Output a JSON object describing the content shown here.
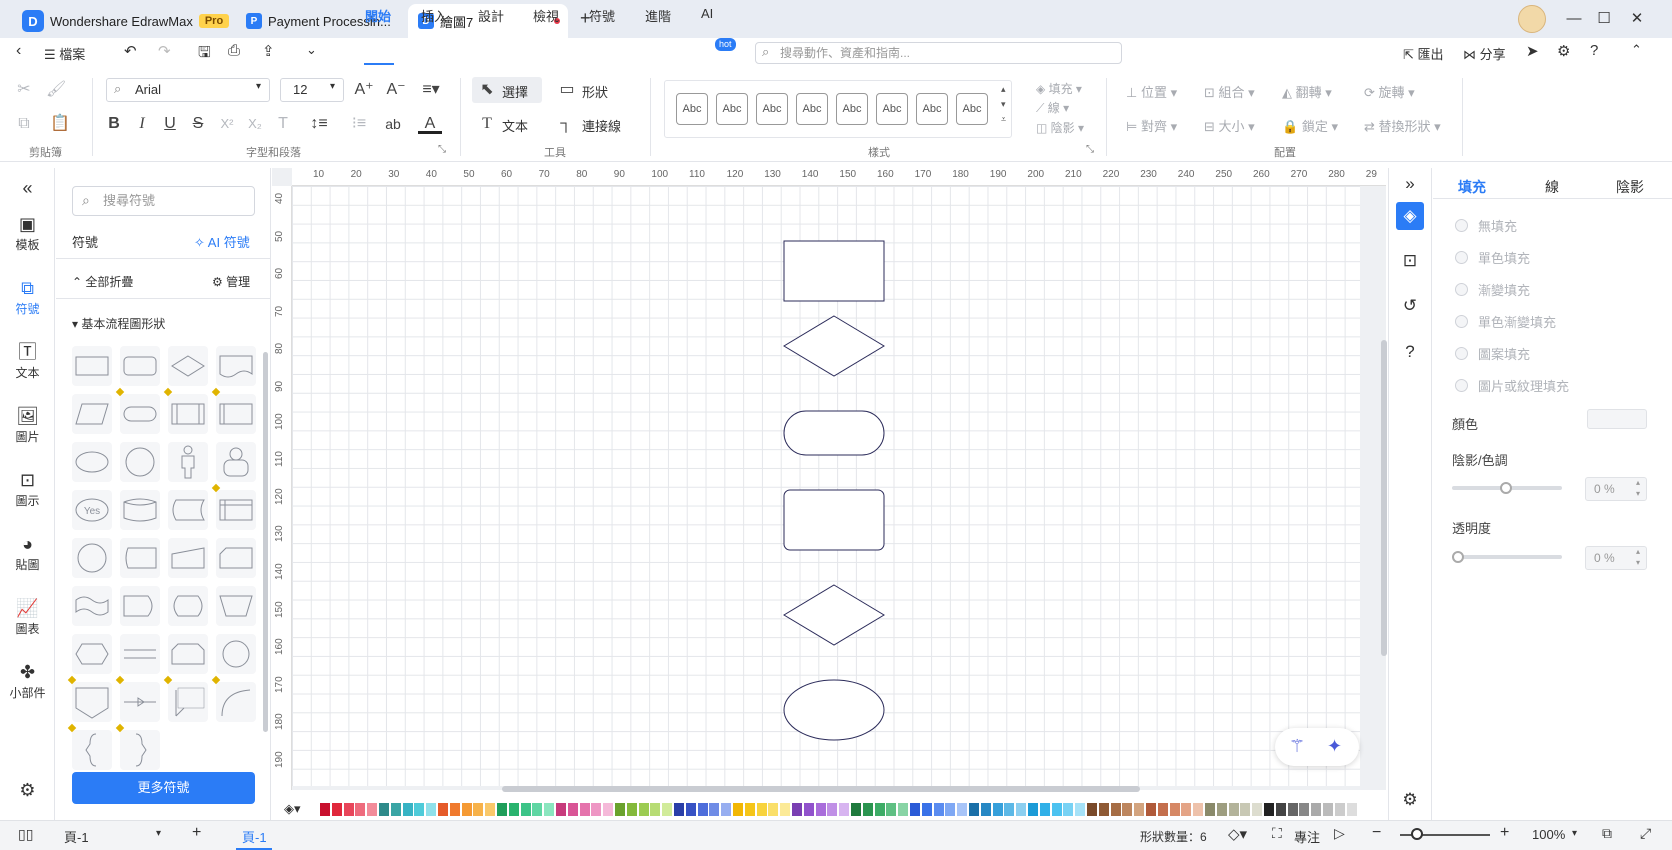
{
  "titlebar": {
    "app_name": "Wondershare EdrawMax",
    "pro_badge": "Pro",
    "tabs": [
      {
        "label": "Payment Processin..."
      },
      {
        "label": "繪圖7"
      }
    ],
    "new_tab": "+",
    "window": {
      "minimize": "—",
      "maximize": "☐",
      "close": "✕"
    }
  },
  "menubar": {
    "file_label": "檔案",
    "items": [
      "開始",
      "插入",
      "設計",
      "檢視",
      "符號",
      "進階",
      "AI"
    ],
    "active_item": "開始",
    "hot_badge": "hot",
    "search_placeholder": "搜尋動作、資產和指南...",
    "export_label": "匯出",
    "share_label": "分享"
  },
  "ribbon": {
    "font_name": "Arial",
    "font_size": "12",
    "groups": {
      "clipboard": "剪貼簿",
      "font_paragraph": "字型和段落",
      "tools": "工具",
      "styles": "樣式",
      "arrange": "配置"
    },
    "tools": {
      "select": "選擇",
      "shape": "形狀",
      "text": "文本",
      "connector": "連接線"
    },
    "style_swatch_label": "Abc",
    "style_swatch_count": 8,
    "style_props": {
      "fill": "填充",
      "line": "線",
      "shadow": "陰影"
    },
    "arrange": {
      "position": "位置",
      "group": "組合",
      "flip": "翻轉",
      "rotate": "旋轉",
      "align": "對齊",
      "size": "大小",
      "lock": "鎖定",
      "replace": "替換形狀"
    },
    "text_format": {
      "bold": "B",
      "italic": "I",
      "underline": "U",
      "strike": "S",
      "sup": "X²",
      "sub": "X₂",
      "ab": "ab",
      "font_color": "A"
    }
  },
  "leftrail": {
    "items": [
      {
        "label": "模板",
        "icon": "template-icon"
      },
      {
        "label": "符號",
        "icon": "symbol-icon"
      },
      {
        "label": "文本",
        "icon": "text-icon"
      },
      {
        "label": "圖片",
        "icon": "image-icon"
      },
      {
        "label": "圖示",
        "icon": "icon-library-icon"
      },
      {
        "label": "貼圖",
        "icon": "sticker-icon"
      },
      {
        "label": "圖表",
        "icon": "chart-icon"
      },
      {
        "label": "小部件",
        "icon": "widget-icon"
      }
    ],
    "active": "符號"
  },
  "sympanel": {
    "search_placeholder": "搜尋符號",
    "title": "符號",
    "ai_symbol": "AI 符號",
    "collapse_all": "全部折疊",
    "manage": "管理",
    "category": "基本流程圖形狀",
    "yes_label": "Yes",
    "more_button": "更多符號"
  },
  "rulers": {
    "top": [
      "10",
      "20",
      "30",
      "40",
      "50",
      "60",
      "70",
      "80",
      "90",
      "100",
      "110",
      "120",
      "130",
      "140",
      "150",
      "160",
      "170",
      "180",
      "190",
      "200",
      "210",
      "220",
      "230",
      "240",
      "250",
      "260",
      "270",
      "280",
      "29"
    ],
    "left": [
      "40",
      "50",
      "60",
      "70",
      "80",
      "90",
      "100",
      "110",
      "120",
      "130",
      "140",
      "150",
      "160",
      "170",
      "180",
      "190"
    ]
  },
  "canvas": {
    "shape_stroke": "#2b2b5a"
  },
  "palette": {
    "colors": [
      "#c8102e",
      "#e0283c",
      "#e8455a",
      "#ee6b7d",
      "#f28c9a",
      "#2e8a8a",
      "#3aa5a5",
      "#37b3c4",
      "#4ecbd9",
      "#8fe0ea",
      "#e55b2a",
      "#f07a2e",
      "#f59a34",
      "#f7b24a",
      "#f9c86a",
      "#1f9e5a",
      "#29b36e",
      "#3cc488",
      "#5fd6a3",
      "#8be6bf",
      "#c73b7c",
      "#d95596",
      "#e573ac",
      "#ee96c4",
      "#f5b9d9",
      "#6aa22d",
      "#84b93b",
      "#9ccc52",
      "#b7dc74",
      "#d1eb9a",
      "#2a3fa8",
      "#3752c4",
      "#4d6ddb",
      "#6f8ce6",
      "#97aef0",
      "#f2b705",
      "#f5c518",
      "#f8d33c",
      "#fadf6a",
      "#fcea97",
      "#7a3fb3",
      "#9152cc",
      "#a96ddb",
      "#c090e6",
      "#d7b4f0",
      "#1f7a3d",
      "#2b9550",
      "#3dac66",
      "#5fc083",
      "#88d4a5",
      "#2a5bd7",
      "#3a72e8",
      "#5a8cf0",
      "#7fa8f4",
      "#a7c4f8",
      "#1a6fa8",
      "#2788c4",
      "#36a0db",
      "#5cb8e6",
      "#8ccff0",
      "#1b9bd7",
      "#30b0e8",
      "#4cc2f0",
      "#78d2f4",
      "#a6e2f8",
      "#7a4a2a",
      "#8f5a35",
      "#a66d45",
      "#bd865e",
      "#d3a47f",
      "#b05a3a",
      "#c46f4d",
      "#d68865",
      "#e4a486",
      "#eec2ab",
      "#8a8a6a",
      "#9e9e80",
      "#b3b39a",
      "#c8c8b4",
      "#ddddcf",
      "#222222",
      "#444444",
      "#666666",
      "#888888",
      "#aaaaaa",
      "#bbbbbb",
      "#cccccc",
      "#dddddd"
    ]
  },
  "righttools": {
    "icons": [
      "collapse-icon",
      "fill-icon",
      "presentation-icon",
      "history-icon",
      "help-icon",
      "settings-icon"
    ]
  },
  "proppanel": {
    "tabs": [
      "填充",
      "線",
      "陰影"
    ],
    "active_tab": "填充",
    "fill_options": [
      "無填充",
      "單色填充",
      "漸變填充",
      "單色漸變填充",
      "圖案填充",
      "圖片或紋理填充"
    ],
    "color_label": "顏色",
    "shade_label": "陰影/色調",
    "shade_value": "0 %",
    "opacity_label": "透明度",
    "opacity_value": "0 %"
  },
  "statusbar": {
    "page_select": "頁-1",
    "add_page": "+",
    "current_page": "頁-1",
    "shape_count": "形狀數量：6",
    "focus": "專注",
    "zoom": "100%"
  }
}
